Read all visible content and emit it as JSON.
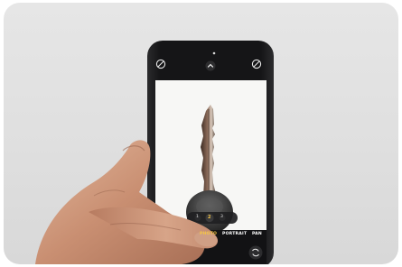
{
  "camera_app": {
    "modes": [
      {
        "label": "PHOTO",
        "selected": true
      },
      {
        "label": "PORTRAIT",
        "selected": false
      },
      {
        "label": "PAN",
        "selected": false
      }
    ],
    "icons": {
      "top_left": "flash-off-icon",
      "top_center_chevron": "chevron-up-icon",
      "top_right": "live-photo-off-icon",
      "flip": "flip-camera-icon"
    },
    "zoom_options": [
      "1",
      "2",
      "3"
    ],
    "colors": {
      "selected_mode": "#f5c542",
      "unselected_mode": "#ffffff",
      "phone_body": "#1b1b1d",
      "viewfinder": "#f7f7f5",
      "background_wall": "#e1e1e1"
    }
  }
}
